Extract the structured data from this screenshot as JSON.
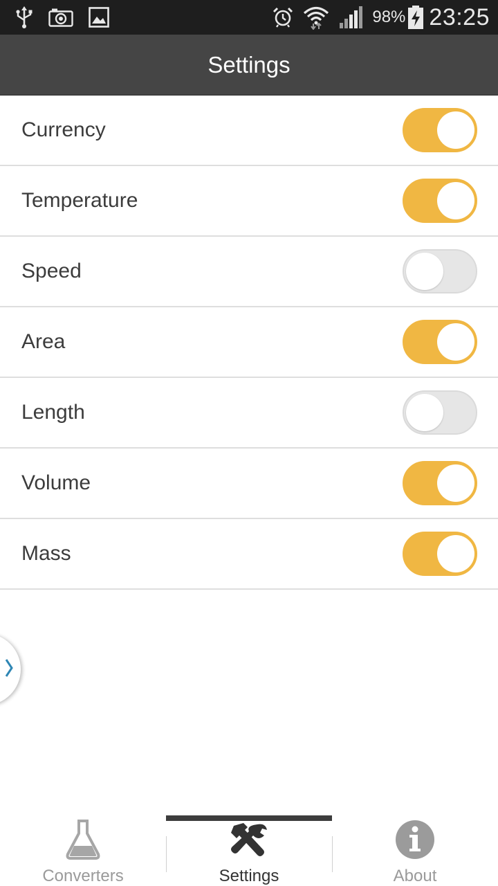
{
  "status_bar": {
    "left_icons": [
      "usb-icon",
      "camera-icon",
      "gallery-icon"
    ],
    "right_icons": [
      "alarm-icon",
      "wifi-icon",
      "signal-icon",
      "battery-charging-icon"
    ],
    "battery": "98%",
    "time": "23:25"
  },
  "header": {
    "title": "Settings"
  },
  "settings": {
    "items": [
      {
        "label": "Currency",
        "enabled": true
      },
      {
        "label": "Temperature",
        "enabled": true
      },
      {
        "label": "Speed",
        "enabled": false
      },
      {
        "label": "Area",
        "enabled": true
      },
      {
        "label": "Length",
        "enabled": false
      },
      {
        "label": "Volume",
        "enabled": true
      },
      {
        "label": "Mass",
        "enabled": true
      }
    ]
  },
  "colors": {
    "toggle_on": "#f0b743",
    "toggle_off": "#e6e6e6",
    "header": "#454545",
    "status_bar": "#1e1e1e",
    "drawer_chevron": "#2e86b4"
  },
  "drawer_handle": {
    "icon": "chevron-right-icon"
  },
  "bottom_nav": {
    "items": [
      {
        "label": "Converters",
        "icon": "flask-icon",
        "active": false
      },
      {
        "label": "Settings",
        "icon": "tools-icon",
        "active": true
      },
      {
        "label": "About",
        "icon": "info-icon",
        "active": false
      }
    ]
  }
}
